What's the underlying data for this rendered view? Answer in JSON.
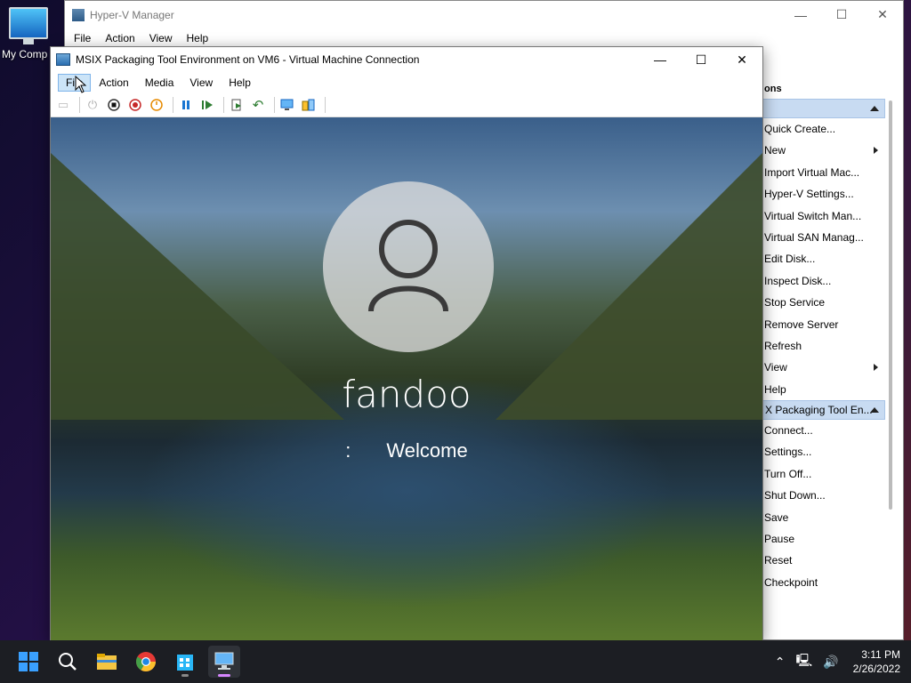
{
  "desktop": {
    "icon_label": "My Comp"
  },
  "hyperv": {
    "title": "Hyper-V Manager",
    "menu": [
      "File",
      "Action",
      "View",
      "Help"
    ],
    "actions_header": "ons",
    "section1_label": "",
    "section1_items": [
      {
        "label": "Quick Create...",
        "sub": false
      },
      {
        "label": "New",
        "sub": true
      },
      {
        "label": "Import Virtual Mac...",
        "sub": false
      },
      {
        "label": "Hyper-V Settings...",
        "sub": false
      },
      {
        "label": "Virtual Switch Man...",
        "sub": false
      },
      {
        "label": "Virtual SAN Manag...",
        "sub": false
      },
      {
        "label": "Edit Disk...",
        "sub": false
      },
      {
        "label": "Inspect Disk...",
        "sub": false
      },
      {
        "label": "Stop Service",
        "sub": false
      },
      {
        "label": "Remove Server",
        "sub": false
      },
      {
        "label": "Refresh",
        "sub": false
      },
      {
        "label": "View",
        "sub": true
      },
      {
        "label": "Help",
        "sub": false
      }
    ],
    "section2_label": "X Packaging Tool En...",
    "section2_items": [
      {
        "label": "Connect...",
        "sub": false
      },
      {
        "label": "Settings...",
        "sub": false
      },
      {
        "label": "Turn Off...",
        "sub": false
      },
      {
        "label": "Shut Down...",
        "sub": false
      },
      {
        "label": "Save",
        "sub": false
      },
      {
        "label": "Pause",
        "sub": false
      },
      {
        "label": "Reset",
        "sub": false
      },
      {
        "label": "Checkpoint",
        "sub": false
      }
    ]
  },
  "vm": {
    "title": "MSIX Packaging Tool Environment on VM6 - Virtual Machine Connection",
    "menu": [
      "File",
      "Action",
      "Media",
      "View",
      "Help"
    ],
    "username": "fandoo",
    "welcome_dots": ":",
    "welcome": "Welcome"
  },
  "taskbar": {
    "time": "3:11 PM",
    "date": "2/26/2022"
  },
  "colors": {
    "accent": "#cce4f7",
    "section_bg": "#c8dbf2",
    "taskbar": "#1c1e23"
  }
}
